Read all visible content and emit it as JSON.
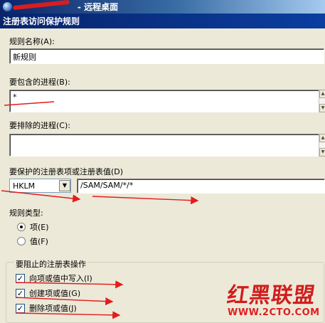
{
  "rdp": {
    "title_suffix": "- 远程桌面"
  },
  "dialog": {
    "title": "注册表访问保护规则"
  },
  "rule_name": {
    "label": "规则名称(A):",
    "value": "新规则"
  },
  "include_process": {
    "label": "要包含的进程(B):",
    "value": "*"
  },
  "exclude_process": {
    "label": "要排除的进程(C):",
    "value": ""
  },
  "protect_key": {
    "label": "要保护的注册表项或注册表值(D)",
    "root_selected": "HKLM",
    "path_value": "/SAM/SAM/*/*"
  },
  "rule_type": {
    "label": "规则类型:",
    "options": [
      {
        "label": "项(E)",
        "checked": true
      },
      {
        "label": "值(F)",
        "checked": false
      }
    ]
  },
  "block_operations": {
    "caption": "要阻止的注册表操作",
    "items": [
      {
        "label": "向项或值中写入(I)",
        "checked": true
      },
      {
        "label": "创建项或值(G)",
        "checked": true
      },
      {
        "label": "删除项或值(J)",
        "checked": true
      }
    ]
  },
  "watermark": {
    "title": "红黑联盟",
    "url": "WWW.2CTO.COM"
  },
  "colors": {
    "dialog_bg": "#ece9d8",
    "titlebar": "#0a246a",
    "annotation": "#e31c1c"
  }
}
